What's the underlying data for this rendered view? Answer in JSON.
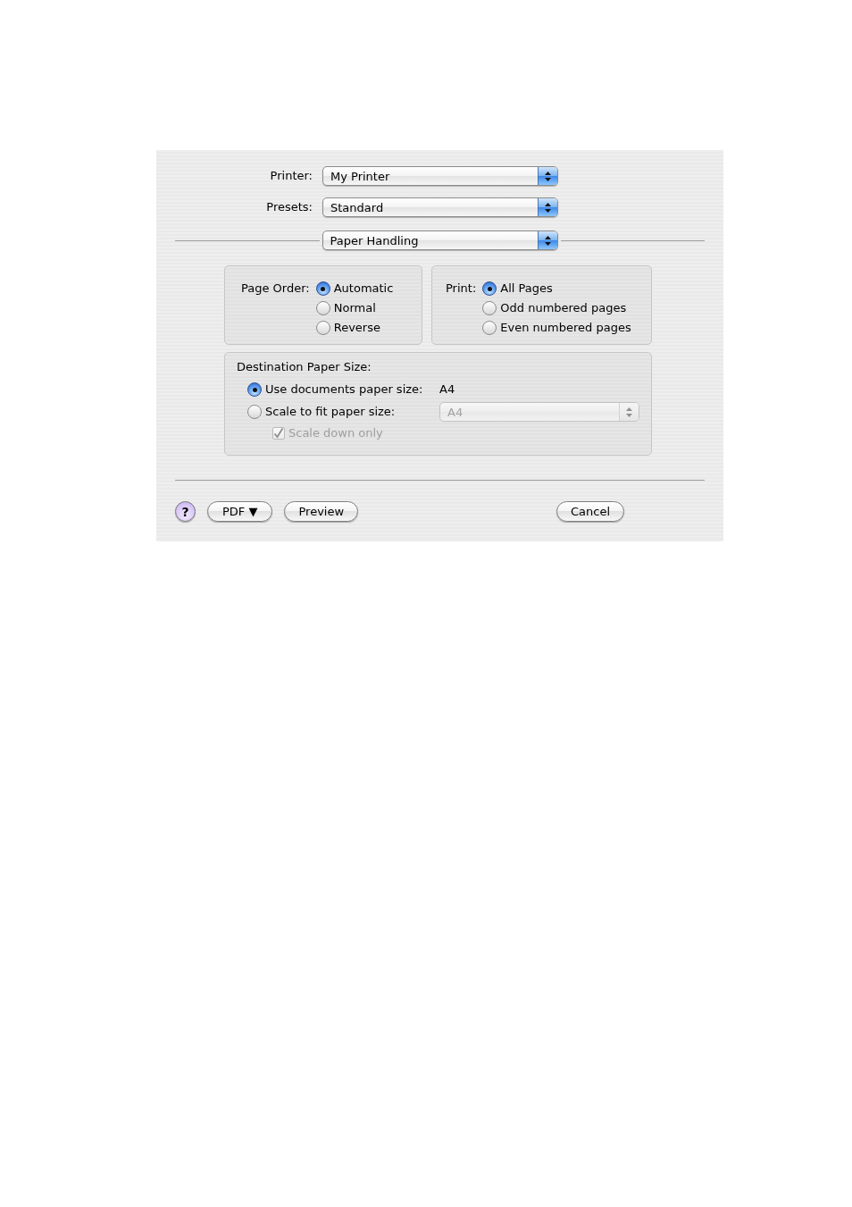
{
  "dialog": {
    "popups": [
      {
        "label": "Printer:",
        "value": "My Printer"
      },
      {
        "label": "Presets:",
        "value": "Standard"
      }
    ],
    "pane_popup": {
      "value": "Paper Handling"
    },
    "groups": [
      {
        "label": "Page Order:",
        "options": [
          {
            "label": "Automatic",
            "selected": true
          },
          {
            "label": "Normal",
            "selected": false
          },
          {
            "label": "Reverse",
            "selected": false
          }
        ]
      },
      {
        "label": "Print:",
        "options": [
          {
            "label": "All Pages",
            "selected": true
          },
          {
            "label": "Odd numbered pages",
            "selected": false
          },
          {
            "label": "Even numbered pages",
            "selected": false
          }
        ]
      }
    ],
    "destination": {
      "title": "Destination Paper Size:",
      "options": [
        {
          "kind": "value",
          "label": "Use documents paper size:",
          "selected": true,
          "value": "A4"
        },
        {
          "kind": "popup",
          "label": "Scale to fit paper size:",
          "selected": false,
          "popup": {
            "value": "A4",
            "disabled": true
          }
        }
      ],
      "checkbox": {
        "label": "Scale down only",
        "checked": true,
        "disabled": true
      }
    },
    "buttons_left": [
      {
        "kind": "help",
        "label": "?"
      },
      {
        "kind": "menu",
        "label": "PDF ▼"
      },
      {
        "kind": "push",
        "label": "Preview"
      }
    ],
    "buttons_right": [
      {
        "kind": "push",
        "label": "Cancel"
      }
    ]
  }
}
